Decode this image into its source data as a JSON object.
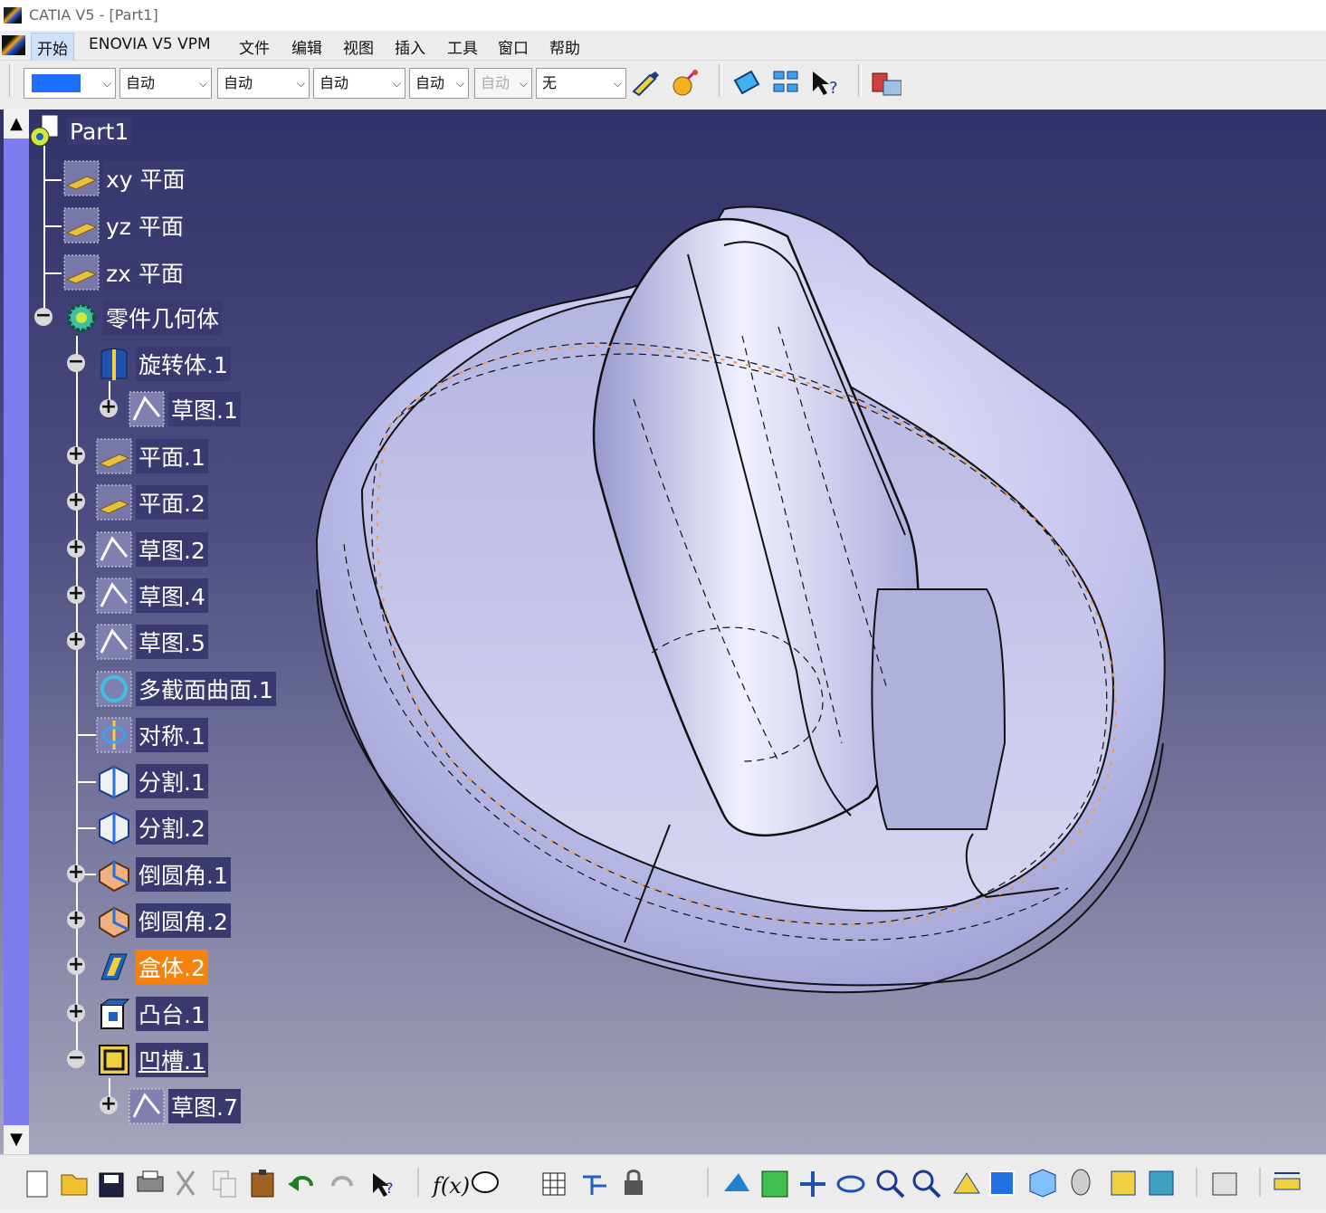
{
  "window": {
    "title": "CATIA V5 - [Part1]"
  },
  "menu": [
    "开始",
    "ENOVIA V5 VPM",
    "文件",
    "编辑",
    "视图",
    "插入",
    "工具",
    "窗口",
    "帮助"
  ],
  "properties_toolbar": {
    "color_swatch": "#1e6fff",
    "transparency": "自动",
    "line_width": "自动",
    "line_type": "自动",
    "point_type": "自动",
    "layer_disabled": "自动",
    "render_style": "无"
  },
  "tree": {
    "root": "Part1",
    "planes": [
      "xy 平面",
      "yz 平面",
      "zx 平面"
    ],
    "body": "零件几何体",
    "revolve": "旋转体.1",
    "revolve_sketch": "草图.1",
    "features": [
      {
        "label": "平面.1",
        "icon": "plane-icon",
        "expand": "+"
      },
      {
        "label": "平面.2",
        "icon": "plane-icon",
        "expand": "+"
      },
      {
        "label": "草图.2",
        "icon": "sketch-icon",
        "expand": "+"
      },
      {
        "label": "草图.4",
        "icon": "sketch-icon",
        "expand": "+"
      },
      {
        "label": "草图.5",
        "icon": "sketch-icon",
        "expand": "+"
      },
      {
        "label": "多截面曲面.1",
        "icon": "multisection-surface-icon",
        "expand": ""
      },
      {
        "label": "对称.1",
        "icon": "symmetry-icon",
        "expand": ""
      },
      {
        "label": "分割.1",
        "icon": "split-icon",
        "expand": ""
      },
      {
        "label": "分割.2",
        "icon": "split-icon",
        "expand": ""
      },
      {
        "label": "倒圆角.1",
        "icon": "fillet-icon",
        "expand": "+"
      },
      {
        "label": "倒圆角.2",
        "icon": "fillet-icon",
        "expand": "+"
      },
      {
        "label": "盒体.2",
        "icon": "shell-icon",
        "expand": "+",
        "selected": true
      },
      {
        "label": "凸台.1",
        "icon": "pad-icon",
        "expand": "+"
      },
      {
        "label": "凹槽.1",
        "icon": "pocket-icon",
        "expand": "−",
        "underline": true
      }
    ],
    "pocket_sketch": "草图.7"
  },
  "colors": {
    "viewport_top": "#32326a",
    "viewport_bottom": "#a4a4bc",
    "model_fill": "#c8c8ee",
    "selection": "#f4820e"
  }
}
